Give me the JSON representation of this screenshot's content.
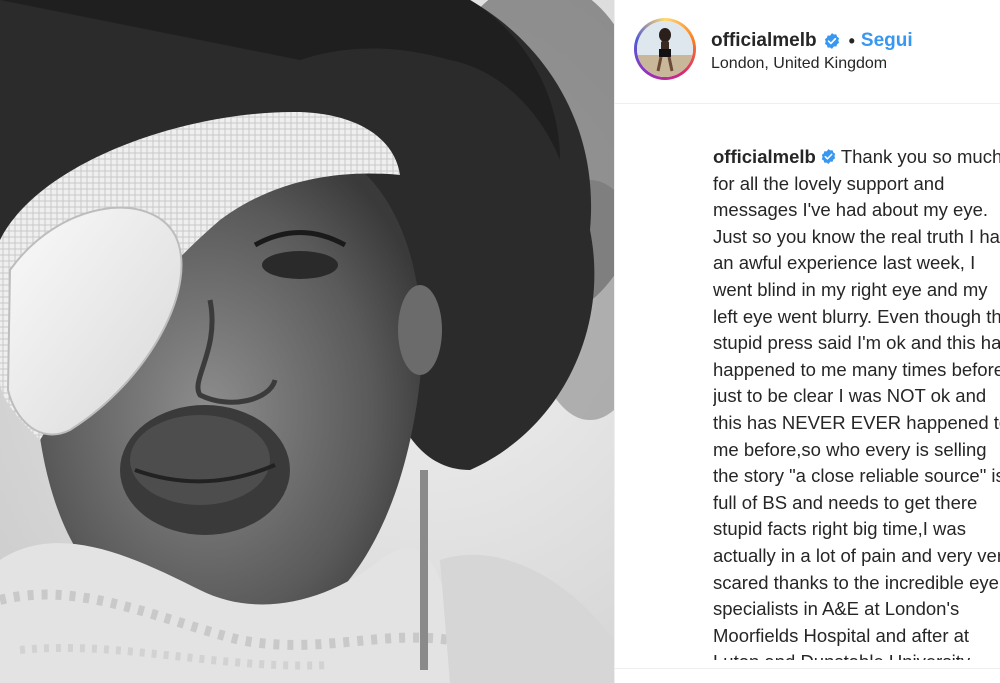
{
  "post": {
    "username": "officialmelb",
    "follow_label": "Segui",
    "separator": "•",
    "location": "London, United Kingdom",
    "verified_icon": "verified-badge-icon",
    "caption_text": "Thank you so much for all the lovely support and messages I've had about my eye. Just so you know the real truth I had an awful experience last week, I went blind in my right eye and my left eye went blurry. Even though the stupid press said I'm ok and this has happened to me many times before just to be clear I was NOT ok and this has NEVER EVER happened to me before,so who every is selling the story \"a close reliable source\" is full of BS and needs to get there stupid facts right big time,I was actually in a lot of pain and very very scared thanks to the incredible eye specialists in A&E at London's Moorfields Hospital and after at Luton and Dunstable University"
  },
  "colors": {
    "link": "#3897f0",
    "text": "#262626",
    "border": "#efefef",
    "verified": "#3897f0"
  }
}
